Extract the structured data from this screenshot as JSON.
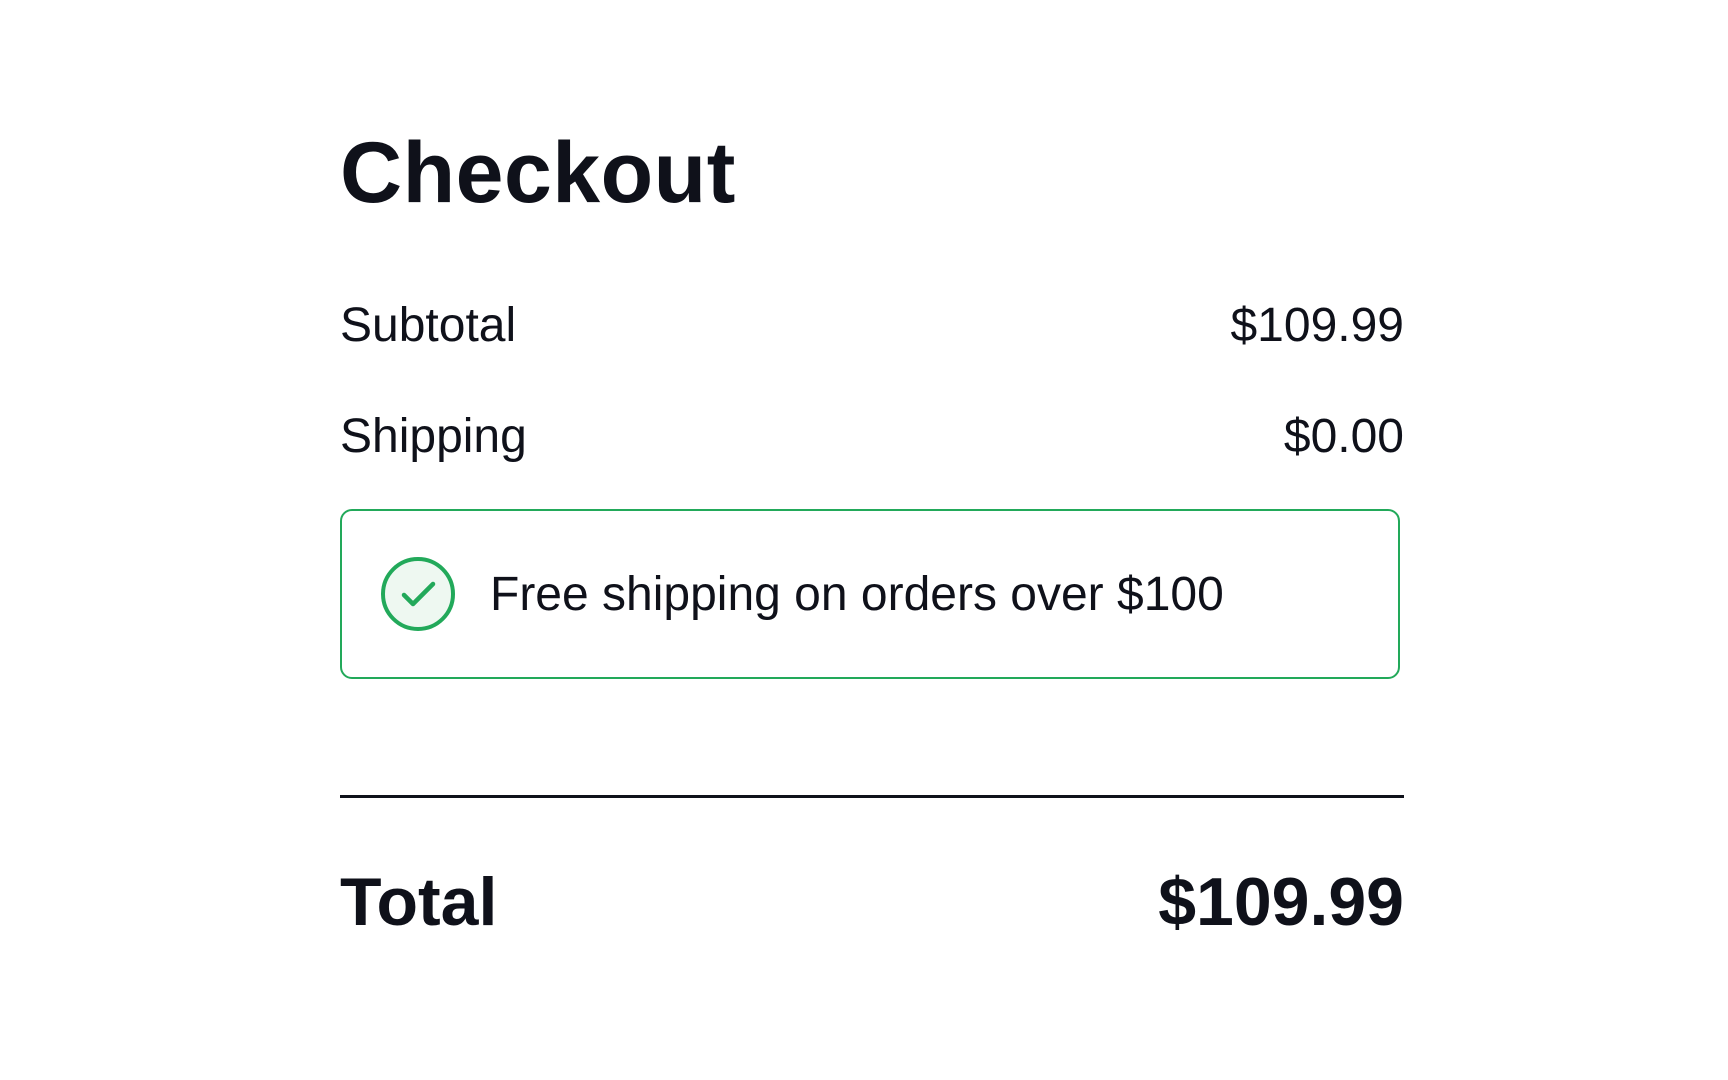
{
  "checkout": {
    "title": "Checkout",
    "subtotal": {
      "label": "Subtotal",
      "value": "$109.99"
    },
    "shipping": {
      "label": "Shipping",
      "value": "$0.00"
    },
    "notice": {
      "icon": "check-circle-icon",
      "text": "Free shipping on orders over $100",
      "border_color": "#22a95a",
      "icon_fill": "#eef8f1"
    },
    "total": {
      "label": "Total",
      "value": "$109.99"
    }
  }
}
